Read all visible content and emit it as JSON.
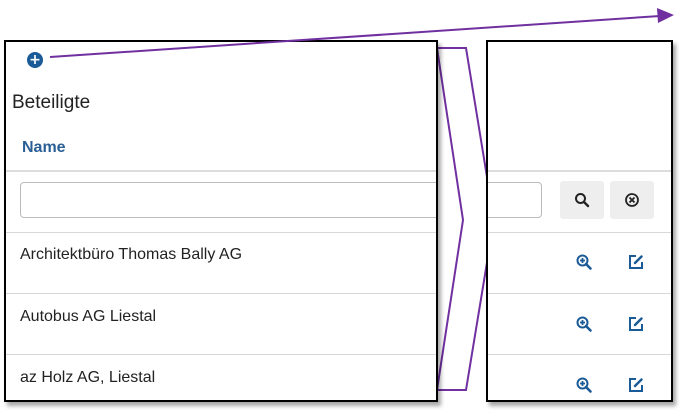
{
  "toolbar": {
    "add_icon": "plus-circle-icon",
    "add_glyph": "+"
  },
  "section": {
    "title": "Beteiligte"
  },
  "table": {
    "columns": [
      {
        "label": "Name"
      }
    ],
    "filter": {
      "value": "",
      "placeholder": "",
      "search_icon": "search-icon",
      "clear_icon": "clear-circle-icon"
    },
    "rows": [
      {
        "name": "Architektbüro Thomas Bally AG",
        "view_icon": "zoom-in-icon",
        "edit_icon": "edit-icon"
      },
      {
        "name": "Autobus AG Liestal",
        "view_icon": "zoom-in-icon",
        "edit_icon": "edit-icon"
      },
      {
        "name": "az Holz AG, Liestal",
        "view_icon": "zoom-in-icon",
        "edit_icon": "edit-icon"
      }
    ]
  },
  "colors": {
    "accent": "#1a5a96",
    "header_text": "#2a5f95",
    "annotation": "#7030a0",
    "panel_border": "#000000"
  }
}
